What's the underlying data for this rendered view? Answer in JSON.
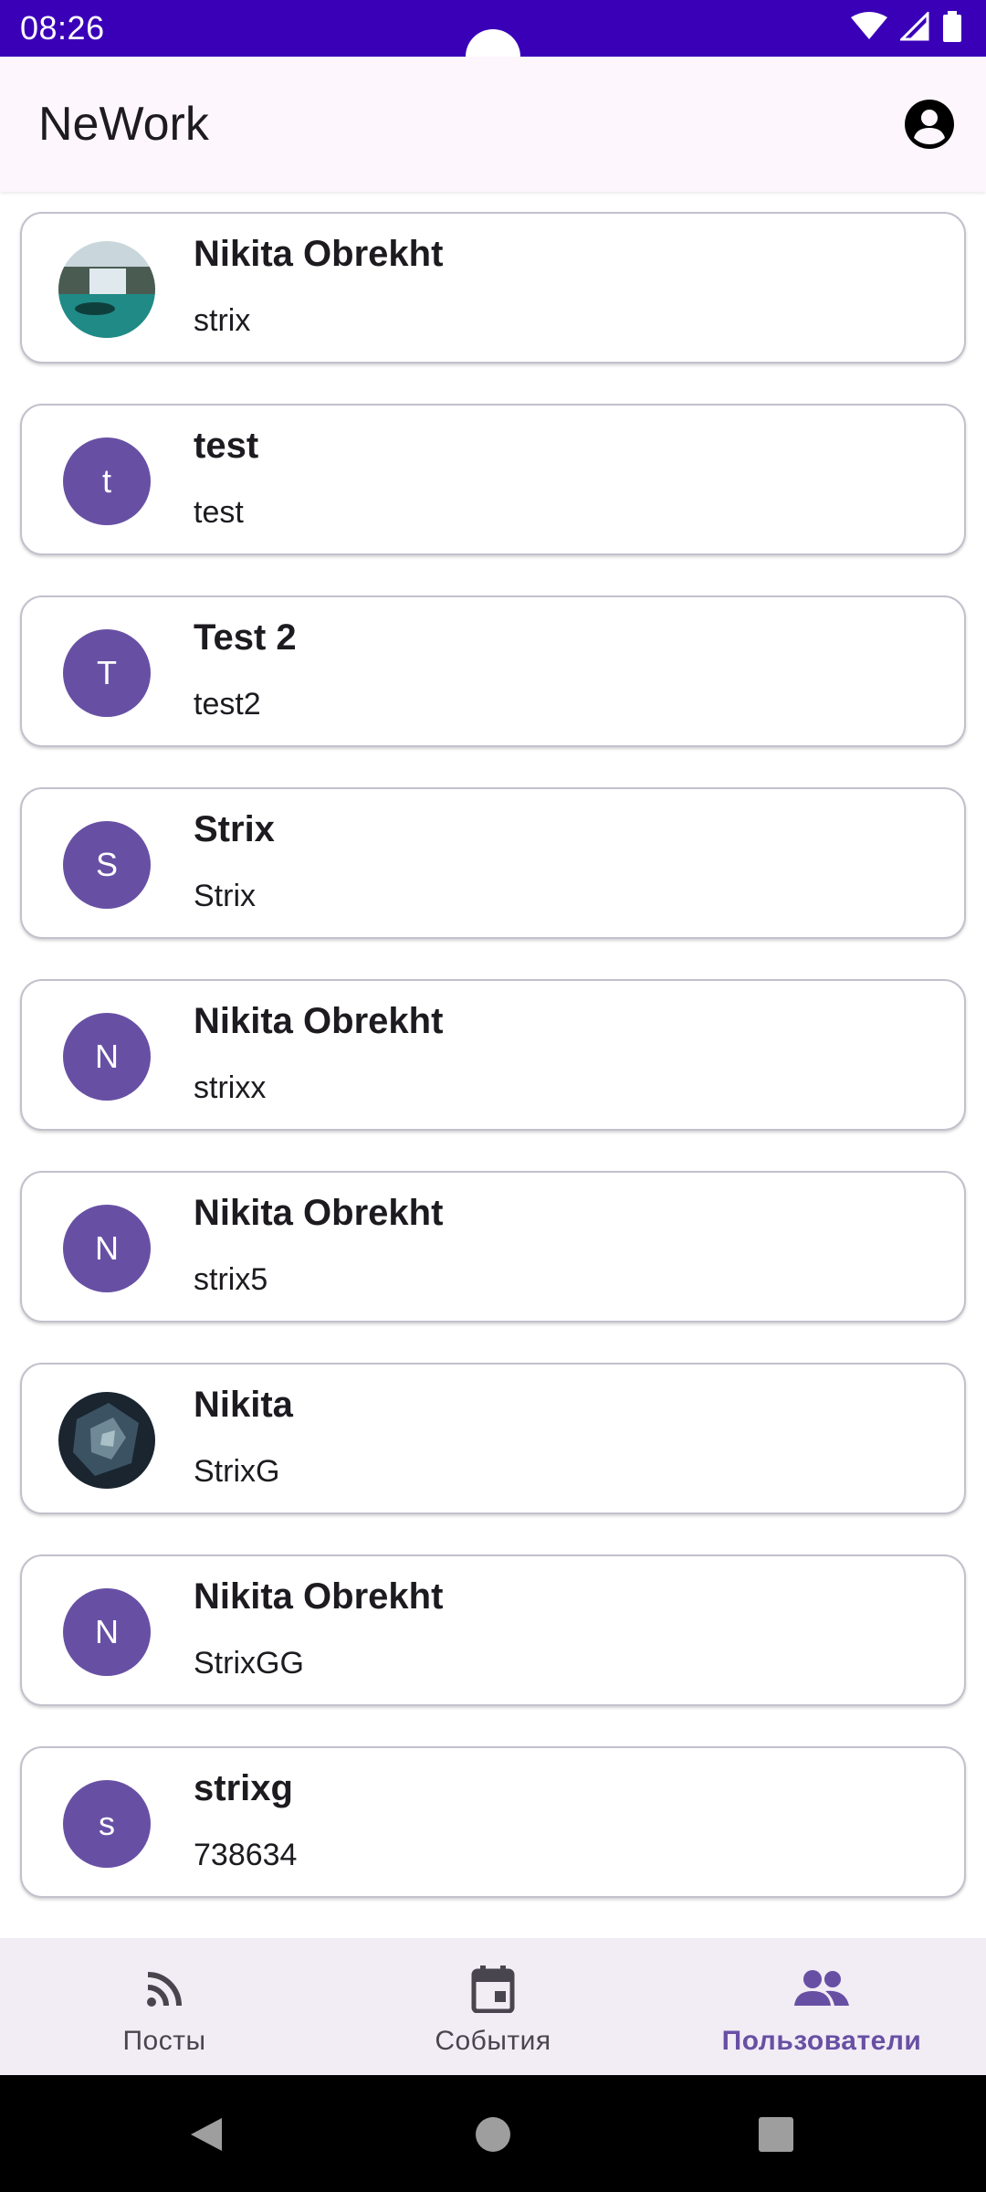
{
  "status_bar": {
    "time": "08:26"
  },
  "app_bar": {
    "title": "NeWork"
  },
  "users": [
    {
      "name": "Nikita Obrekht",
      "login": "strix",
      "avatar": {
        "type": "photo",
        "desc": "waterfall"
      }
    },
    {
      "name": "test",
      "login": "test",
      "avatar": {
        "type": "letter",
        "letter": "t"
      }
    },
    {
      "name": "Test 2",
      "login": "test2",
      "avatar": {
        "type": "letter",
        "letter": "T"
      }
    },
    {
      "name": "Strix",
      "login": "Strix",
      "avatar": {
        "type": "letter",
        "letter": "S"
      }
    },
    {
      "name": "Nikita Obrekht",
      "login": "strixx",
      "avatar": {
        "type": "letter",
        "letter": "N"
      }
    },
    {
      "name": "Nikita Obrekht",
      "login": "strix5",
      "avatar": {
        "type": "letter",
        "letter": "N"
      }
    },
    {
      "name": "Nikita",
      "login": "StrixG",
      "avatar": {
        "type": "photo",
        "desc": "dark-crystal"
      }
    },
    {
      "name": "Nikita Obrekht",
      "login": "StrixGG",
      "avatar": {
        "type": "letter",
        "letter": "N"
      }
    },
    {
      "name": "strixg",
      "login": "738634",
      "avatar": {
        "type": "letter",
        "letter": "s"
      }
    }
  ],
  "bottom_nav": {
    "items": [
      {
        "label": "Посты",
        "icon": "rss-feed-icon",
        "active": false
      },
      {
        "label": "События",
        "icon": "calendar-event-icon",
        "active": false
      },
      {
        "label": "Пользователи",
        "icon": "people-icon",
        "active": true
      }
    ]
  },
  "colors": {
    "status_bar": "#3a00b8",
    "accent": "#6750a4",
    "app_bar_bg": "#fdf6fd",
    "nav_bg": "#f2ecf5"
  }
}
